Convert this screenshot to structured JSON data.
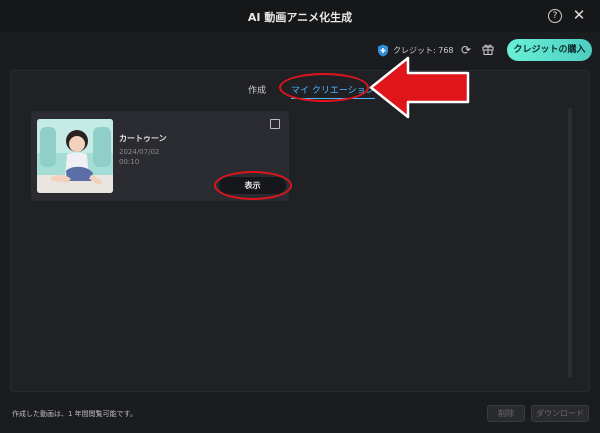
{
  "window": {
    "title": "AI 動画アニメ化生成",
    "help_icon": "question-circle-icon",
    "close_icon": "close-icon"
  },
  "topbar": {
    "credit_icon": "shield-plus-icon",
    "credits_label": "クレジット: 768",
    "refresh_icon": "refresh-icon",
    "gift_icon": "gift-icon",
    "buy_label": "クレジットの購入"
  },
  "tabs": {
    "create": "作成",
    "my_creation": "マイ クリエーション",
    "active": "my_creation"
  },
  "card": {
    "title": "カートゥーン",
    "date": "2024/07/02",
    "duration": "00:10",
    "view_label": "表示",
    "checked": false
  },
  "footer": {
    "notice": "作成した動画は、1 年間閲覧可能です。",
    "delete_label": "削除",
    "download_label": "ダウンロード"
  },
  "colors": {
    "accent": "#4db8ff",
    "buy_button": "#5fe1cc",
    "annotation_red": "#e0141b",
    "background": "#1b1c1f"
  }
}
